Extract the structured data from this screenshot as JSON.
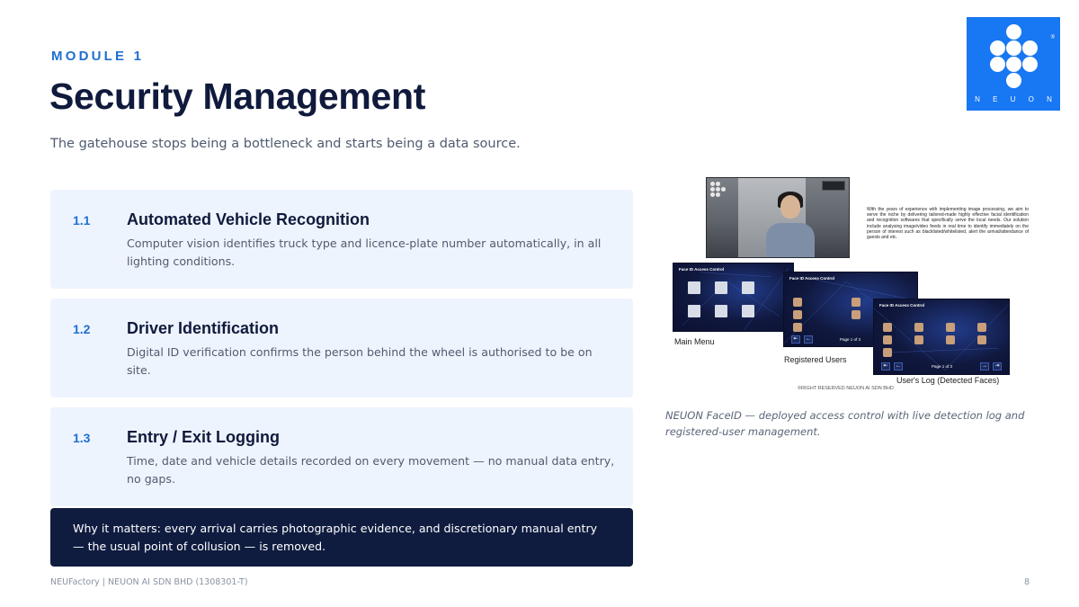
{
  "header": {
    "eyebrow": "MODULE 1",
    "title": "Security Management",
    "subtitle": "The gatehouse stops being a bottleneck and starts being a data source."
  },
  "logo": {
    "wordmark": "N E U O N",
    "registered": "®"
  },
  "features": [
    {
      "number": "1.1",
      "title": "Automated Vehicle Recognition",
      "description": "Computer vision identifies truck type and licence-plate number automatically, in all lighting conditions."
    },
    {
      "number": "1.2",
      "title": "Driver Identification",
      "description": "Digital ID verification confirms the person behind the wheel is authorised to be on site."
    },
    {
      "number": "1.3",
      "title": "Entry / Exit Logging",
      "description": "Time, date and vehicle details recorded on every movement — no manual data entry, no gaps."
    }
  ],
  "callout": {
    "text": "Why it matters:  every arrival carries photographic evidence, and discretionary manual entry — the usual point of collusion — is removed."
  },
  "figure": {
    "blurb": "With the years of experience with implementing image processing, we aim to serve the niche by delivering tailored-made highly effective facial identification and recognition softwares that specifically serve the local needs. Our solution include analysing image/video feeds in real time to identify immediately on the person of interest such as blacklisted/whitelisted, alert the arrival/attendance of guests and etc.",
    "screens": [
      {
        "header": "Face ID Access Control",
        "caption": "Main Menu"
      },
      {
        "header": "Face ID Access Control",
        "caption": "Registered Users",
        "pager": "Page 1 of 3"
      },
      {
        "header": "Face ID Access Control",
        "caption": "User's Log (Detected Faces)",
        "pager": "Page 1 of 3"
      }
    ],
    "rights": "©RIGHT RESERVED NEUON AI SDN BHD",
    "caption": "NEUON FaceID — deployed access control with live detection log and registered-user management."
  },
  "footer": {
    "left": "NEUFactory  |  NEUON AI SDN BHD (1308301-T)",
    "page": "8"
  },
  "colors": {
    "accent": "#1f6fd1",
    "title": "#101a3c",
    "card_bg": "#eef4fe",
    "callout_bg": "#0f1c3f",
    "logo_bg": "#1877f2"
  }
}
